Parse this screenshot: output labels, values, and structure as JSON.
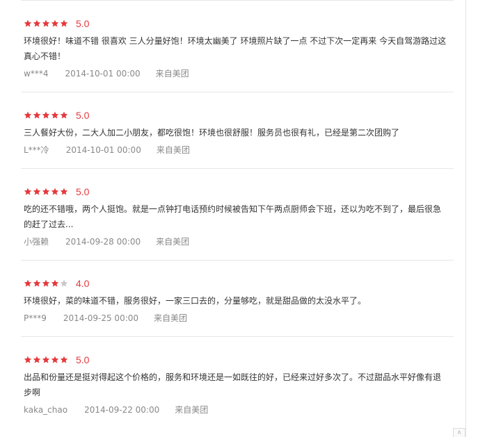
{
  "colors": {
    "star_filled": "#e4393c",
    "star_empty": "#c8c8c8",
    "score": "#e4393c",
    "meta": "#888888",
    "text": "#333333"
  },
  "reviews": [
    {
      "stars": 5,
      "score": "5.0",
      "content": "环境很好！味道不错 很喜欢 三人分量好饱！环境太幽美了 环境照片缺了一点 不过下次一定再来 今天自驾游路过这真心不错！",
      "user": "w***4",
      "date": "2014-10-01 00:00",
      "source": "来自美团"
    },
    {
      "stars": 5,
      "score": "5.0",
      "content": "三人餐好大份，二大人加二小朋友，都吃很饱！环境也很舒服！服务员也很有礼，已经是第二次团购了",
      "user": "L***冷",
      "date": "2014-10-01 00:00",
      "source": "来自美团"
    },
    {
      "stars": 5,
      "score": "5.0",
      "content": "吃的还不错哦，两个人挺饱。就是一点钟打电话预约时候被告知下午两点厨师会下班，还以为吃不到了，最后很急的赶了过去...",
      "user": "小强赖",
      "date": "2014-09-28 00:00",
      "source": "来自美团"
    },
    {
      "stars": 4,
      "score": "4.0",
      "content": "环境很好，菜的味道不错，服务很好，一家三口去的，分量够吃，就是甜品做的太没水平了。",
      "user": "P***9",
      "date": "2014-09-25 00:00",
      "source": "来自美团"
    },
    {
      "stars": 5,
      "score": "5.0",
      "content": "出品和份量还是挺对得起这个价格的，服务和环境还是一如既往的好，已经来过好多次了。不过甜品水平好像有退步啊",
      "user": "kaka_chao",
      "date": "2014-09-22 00:00",
      "source": "来自美团"
    }
  ]
}
